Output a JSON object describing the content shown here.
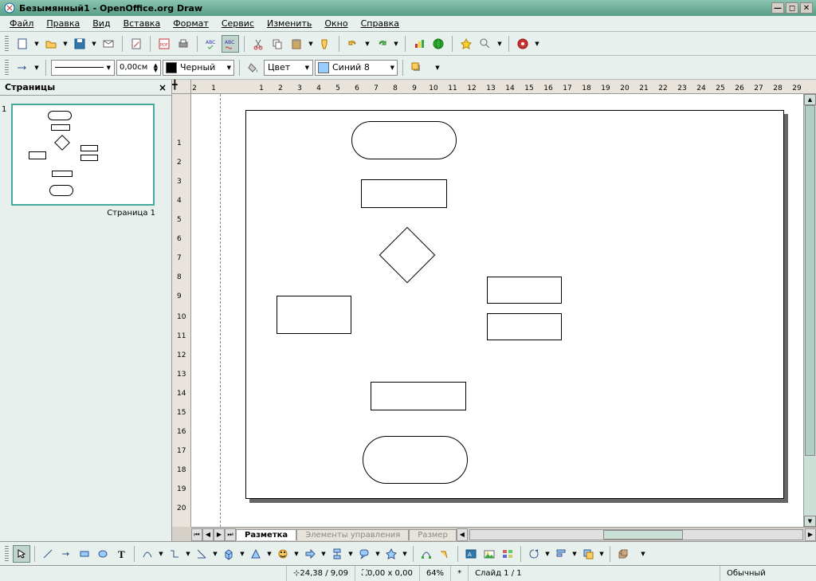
{
  "window": {
    "title": "Безымянный1 - OpenOffice.org Draw"
  },
  "menu": {
    "file": "Файл",
    "edit": "Правка",
    "view": "Вид",
    "insert": "Вставка",
    "format": "Формат",
    "tools": "Сервис",
    "modify": "Изменить",
    "window": "Окно",
    "help": "Справка"
  },
  "toolbar2": {
    "line_width": "0,00см",
    "line_color_label": "Черный",
    "line_color": "#000000",
    "fill_label": "Цвет",
    "fill_color_label": "Синий 8",
    "fill_color": "#99ccff"
  },
  "pages_panel": {
    "title": "Страницы",
    "thumb_label": "Страница 1",
    "page_num": "1"
  },
  "tabs": {
    "layout": "Разметка",
    "controls": "Элементы управления",
    "dims": "Размер"
  },
  "status": {
    "coords": "24,38 / 9,09",
    "size": "0,00 x 0,00",
    "zoom": "64%",
    "modified": "*",
    "slide": "Слайд 1 / 1",
    "mode": "Обычный"
  },
  "h_ruler_ticks": [
    "2",
    "1",
    "1",
    "2",
    "3",
    "4",
    "5",
    "6",
    "7",
    "8",
    "9",
    "10",
    "11",
    "12",
    "13",
    "14",
    "15",
    "16",
    "17",
    "18",
    "19",
    "20",
    "21",
    "22",
    "23",
    "24",
    "25",
    "26",
    "27",
    "28",
    "29"
  ],
  "h_ruler_positions": [
    4,
    28,
    88,
    112,
    136,
    160,
    184,
    208,
    232,
    256,
    280,
    304,
    328,
    352,
    376,
    400,
    424,
    448,
    472,
    496,
    520,
    544,
    568,
    592,
    616,
    640,
    664,
    688,
    712,
    736,
    760
  ],
  "v_ruler_ticks": [
    "1",
    "2",
    "3",
    "4",
    "5",
    "6",
    "7",
    "8",
    "9",
    "10",
    "11",
    "12",
    "13",
    "14",
    "15",
    "16",
    "17",
    "18",
    "19",
    "20"
  ],
  "v_ruler_positions": [
    62,
    86,
    110,
    134,
    158,
    182,
    206,
    230,
    254,
    280,
    304,
    328,
    352,
    376,
    400,
    424,
    448,
    472,
    496,
    520
  ]
}
